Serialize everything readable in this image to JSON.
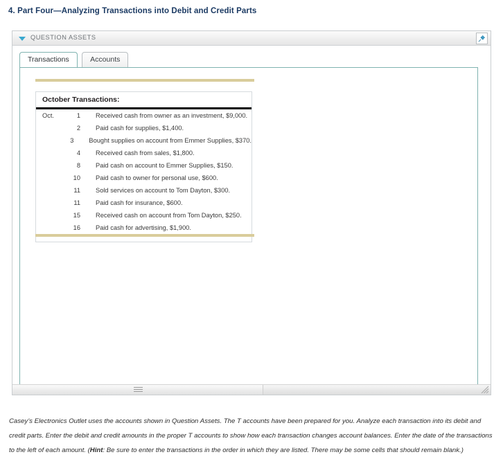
{
  "page_title": "4. Part Four—Analyzing Transactions into Debit and Credit Parts",
  "panel": {
    "header_label": "QUESTION ASSETS",
    "caret_icon": "triangle-down-icon",
    "caret_color": "#39a8cf",
    "pin_icon": "pushpin-icon",
    "pin_color": "#2e8fc0"
  },
  "tabs": [
    {
      "label": "Transactions",
      "active": true
    },
    {
      "label": "Accounts",
      "active": false
    }
  ],
  "rule_color": "#d9cc9b",
  "transactions": {
    "title": "October Transactions:",
    "month_label": "Oct.",
    "rows": [
      {
        "month": "Oct.",
        "day": "1",
        "description": "Received cash from owner as an investment, $9,000."
      },
      {
        "month": "",
        "day": "2",
        "description": "Paid cash for supplies, $1,400."
      },
      {
        "month": "",
        "day": "3",
        "description": "Bought supplies on account from Emmer Supplies, $370."
      },
      {
        "month": "",
        "day": "4",
        "description": "Received cash from sales, $1,800."
      },
      {
        "month": "",
        "day": "8",
        "description": "Paid cash on account to Emmer Supplies, $150."
      },
      {
        "month": "",
        "day": "10",
        "description": "Paid cash to owner for personal use, $600."
      },
      {
        "month": "",
        "day": "11",
        "description": "Sold services on account to Tom Dayton, $300."
      },
      {
        "month": "",
        "day": "11",
        "description": "Paid cash for insurance, $600."
      },
      {
        "month": "",
        "day": "15",
        "description": "Received cash on account from Tom Dayton, $250."
      },
      {
        "month": "",
        "day": "16",
        "description": "Paid cash for advertising, $1,900."
      }
    ]
  },
  "scrollbar": {
    "grip_icon": "horizontal-grip-icon",
    "resize_icon": "resize-corner-icon"
  },
  "instructions": {
    "part1": "Casey’s Electronics Outlet uses the accounts shown in Question Assets. The T accounts have been prepared for you. Analyze each transaction into its debit and credit parts. Enter the debit and credit amounts in the proper T accounts to show how each transaction changes account balances. Enter the date of the transactions to the left of each amount. (",
    "hint_label": "Hint",
    "part2": ": Be sure to enter the transactions in the order in which they are listed. There may be some cells that should remain blank.)"
  }
}
